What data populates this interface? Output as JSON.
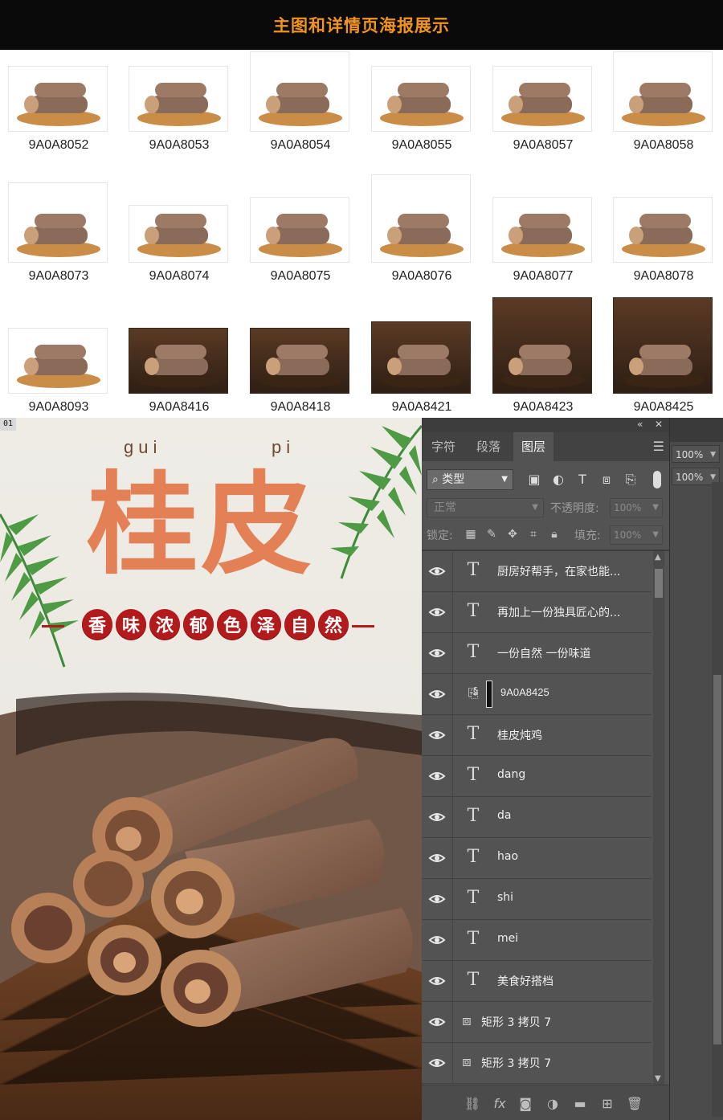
{
  "banner": {
    "title": "主图和详情页海报展示"
  },
  "thumbnails": [
    {
      "label": "9A0A8052"
    },
    {
      "label": "9A0A8053"
    },
    {
      "label": "9A0A8054"
    },
    {
      "label": "9A0A8055"
    },
    {
      "label": "9A0A8057"
    },
    {
      "label": "9A0A8058"
    },
    {
      "label": "9A0A8073"
    },
    {
      "label": "9A0A8074"
    },
    {
      "label": "9A0A8075"
    },
    {
      "label": "9A0A8076"
    },
    {
      "label": "9A0A8077"
    },
    {
      "label": "9A0A8078"
    },
    {
      "label": "9A0A8093"
    },
    {
      "label": "9A0A8416"
    },
    {
      "label": "9A0A8418"
    },
    {
      "label": "9A0A8421"
    },
    {
      "label": "9A0A8423"
    },
    {
      "label": "9A0A8425"
    }
  ],
  "canvas": {
    "tab": "01",
    "pinyin_left": "gui",
    "pinyin_right": "pi",
    "title": "桂皮",
    "slogan_a": [
      "香",
      "味",
      "浓",
      "郁"
    ],
    "slogan_b": [
      "色",
      "泽",
      "自",
      "然"
    ]
  },
  "panel": {
    "tabs": [
      "字符",
      "段落",
      "图层"
    ],
    "active_tab": "图层",
    "filter_kind": "类型",
    "blend_mode": "正常",
    "opacity_label": "不透明度:",
    "opacity_value": "100%",
    "lock_label": "锁定:",
    "fill_label": "填充:",
    "fill_value": "100%",
    "layers": [
      {
        "type": "text",
        "name": "厨房好帮手，在家也能..."
      },
      {
        "type": "text",
        "name": "再加上一份独具匠心的..."
      },
      {
        "type": "text",
        "name": "一份自然 一份味道"
      },
      {
        "type": "smart",
        "name": "9A0A8425"
      },
      {
        "type": "text",
        "name": "桂皮炖鸡"
      },
      {
        "type": "text",
        "name": "dang"
      },
      {
        "type": "text",
        "name": "da"
      },
      {
        "type": "text",
        "name": "hao"
      },
      {
        "type": "text",
        "name": "shi"
      },
      {
        "type": "text",
        "name": "mei"
      },
      {
        "type": "text",
        "name": "美食好搭档"
      },
      {
        "type": "shape",
        "name": "矩形 3 拷贝 7"
      },
      {
        "type": "shape",
        "name": "矩形 3 拷贝 7"
      }
    ]
  },
  "strip": {
    "zoom1": "100%",
    "zoom2": "100%"
  },
  "colors": {
    "accent": "#f2941c",
    "title_orange": "#e48056",
    "pill_red": "#b31a1c",
    "panel_bg": "#535353"
  }
}
